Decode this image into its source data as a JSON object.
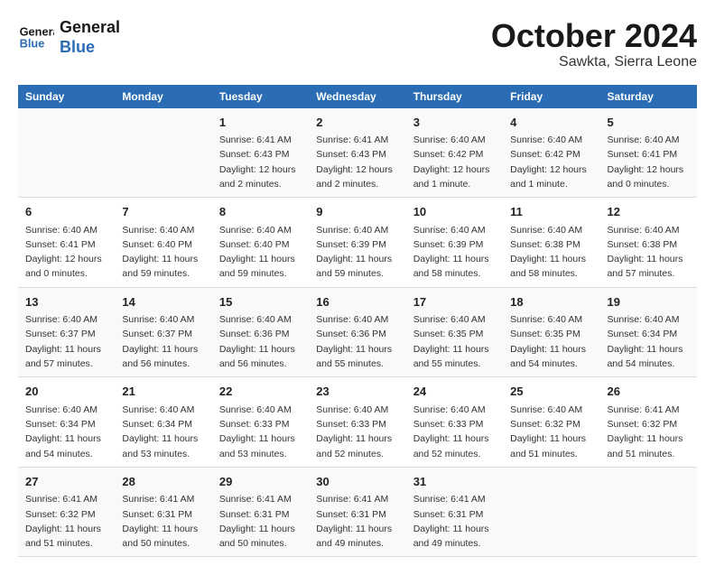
{
  "header": {
    "logo_line1": "General",
    "logo_line2": "Blue",
    "month": "October 2024",
    "location": "Sawkta, Sierra Leone"
  },
  "days_of_week": [
    "Sunday",
    "Monday",
    "Tuesday",
    "Wednesday",
    "Thursday",
    "Friday",
    "Saturday"
  ],
  "weeks": [
    [
      {
        "day": "",
        "info": ""
      },
      {
        "day": "",
        "info": ""
      },
      {
        "day": "1",
        "info": "Sunrise: 6:41 AM\nSunset: 6:43 PM\nDaylight: 12 hours\nand 2 minutes."
      },
      {
        "day": "2",
        "info": "Sunrise: 6:41 AM\nSunset: 6:43 PM\nDaylight: 12 hours\nand 2 minutes."
      },
      {
        "day": "3",
        "info": "Sunrise: 6:40 AM\nSunset: 6:42 PM\nDaylight: 12 hours\nand 1 minute."
      },
      {
        "day": "4",
        "info": "Sunrise: 6:40 AM\nSunset: 6:42 PM\nDaylight: 12 hours\nand 1 minute."
      },
      {
        "day": "5",
        "info": "Sunrise: 6:40 AM\nSunset: 6:41 PM\nDaylight: 12 hours\nand 0 minutes."
      }
    ],
    [
      {
        "day": "6",
        "info": "Sunrise: 6:40 AM\nSunset: 6:41 PM\nDaylight: 12 hours\nand 0 minutes."
      },
      {
        "day": "7",
        "info": "Sunrise: 6:40 AM\nSunset: 6:40 PM\nDaylight: 11 hours\nand 59 minutes."
      },
      {
        "day": "8",
        "info": "Sunrise: 6:40 AM\nSunset: 6:40 PM\nDaylight: 11 hours\nand 59 minutes."
      },
      {
        "day": "9",
        "info": "Sunrise: 6:40 AM\nSunset: 6:39 PM\nDaylight: 11 hours\nand 59 minutes."
      },
      {
        "day": "10",
        "info": "Sunrise: 6:40 AM\nSunset: 6:39 PM\nDaylight: 11 hours\nand 58 minutes."
      },
      {
        "day": "11",
        "info": "Sunrise: 6:40 AM\nSunset: 6:38 PM\nDaylight: 11 hours\nand 58 minutes."
      },
      {
        "day": "12",
        "info": "Sunrise: 6:40 AM\nSunset: 6:38 PM\nDaylight: 11 hours\nand 57 minutes."
      }
    ],
    [
      {
        "day": "13",
        "info": "Sunrise: 6:40 AM\nSunset: 6:37 PM\nDaylight: 11 hours\nand 57 minutes."
      },
      {
        "day": "14",
        "info": "Sunrise: 6:40 AM\nSunset: 6:37 PM\nDaylight: 11 hours\nand 56 minutes."
      },
      {
        "day": "15",
        "info": "Sunrise: 6:40 AM\nSunset: 6:36 PM\nDaylight: 11 hours\nand 56 minutes."
      },
      {
        "day": "16",
        "info": "Sunrise: 6:40 AM\nSunset: 6:36 PM\nDaylight: 11 hours\nand 55 minutes."
      },
      {
        "day": "17",
        "info": "Sunrise: 6:40 AM\nSunset: 6:35 PM\nDaylight: 11 hours\nand 55 minutes."
      },
      {
        "day": "18",
        "info": "Sunrise: 6:40 AM\nSunset: 6:35 PM\nDaylight: 11 hours\nand 54 minutes."
      },
      {
        "day": "19",
        "info": "Sunrise: 6:40 AM\nSunset: 6:34 PM\nDaylight: 11 hours\nand 54 minutes."
      }
    ],
    [
      {
        "day": "20",
        "info": "Sunrise: 6:40 AM\nSunset: 6:34 PM\nDaylight: 11 hours\nand 54 minutes."
      },
      {
        "day": "21",
        "info": "Sunrise: 6:40 AM\nSunset: 6:34 PM\nDaylight: 11 hours\nand 53 minutes."
      },
      {
        "day": "22",
        "info": "Sunrise: 6:40 AM\nSunset: 6:33 PM\nDaylight: 11 hours\nand 53 minutes."
      },
      {
        "day": "23",
        "info": "Sunrise: 6:40 AM\nSunset: 6:33 PM\nDaylight: 11 hours\nand 52 minutes."
      },
      {
        "day": "24",
        "info": "Sunrise: 6:40 AM\nSunset: 6:33 PM\nDaylight: 11 hours\nand 52 minutes."
      },
      {
        "day": "25",
        "info": "Sunrise: 6:40 AM\nSunset: 6:32 PM\nDaylight: 11 hours\nand 51 minutes."
      },
      {
        "day": "26",
        "info": "Sunrise: 6:41 AM\nSunset: 6:32 PM\nDaylight: 11 hours\nand 51 minutes."
      }
    ],
    [
      {
        "day": "27",
        "info": "Sunrise: 6:41 AM\nSunset: 6:32 PM\nDaylight: 11 hours\nand 51 minutes."
      },
      {
        "day": "28",
        "info": "Sunrise: 6:41 AM\nSunset: 6:31 PM\nDaylight: 11 hours\nand 50 minutes."
      },
      {
        "day": "29",
        "info": "Sunrise: 6:41 AM\nSunset: 6:31 PM\nDaylight: 11 hours\nand 50 minutes."
      },
      {
        "day": "30",
        "info": "Sunrise: 6:41 AM\nSunset: 6:31 PM\nDaylight: 11 hours\nand 49 minutes."
      },
      {
        "day": "31",
        "info": "Sunrise: 6:41 AM\nSunset: 6:31 PM\nDaylight: 11 hours\nand 49 minutes."
      },
      {
        "day": "",
        "info": ""
      },
      {
        "day": "",
        "info": ""
      }
    ]
  ]
}
